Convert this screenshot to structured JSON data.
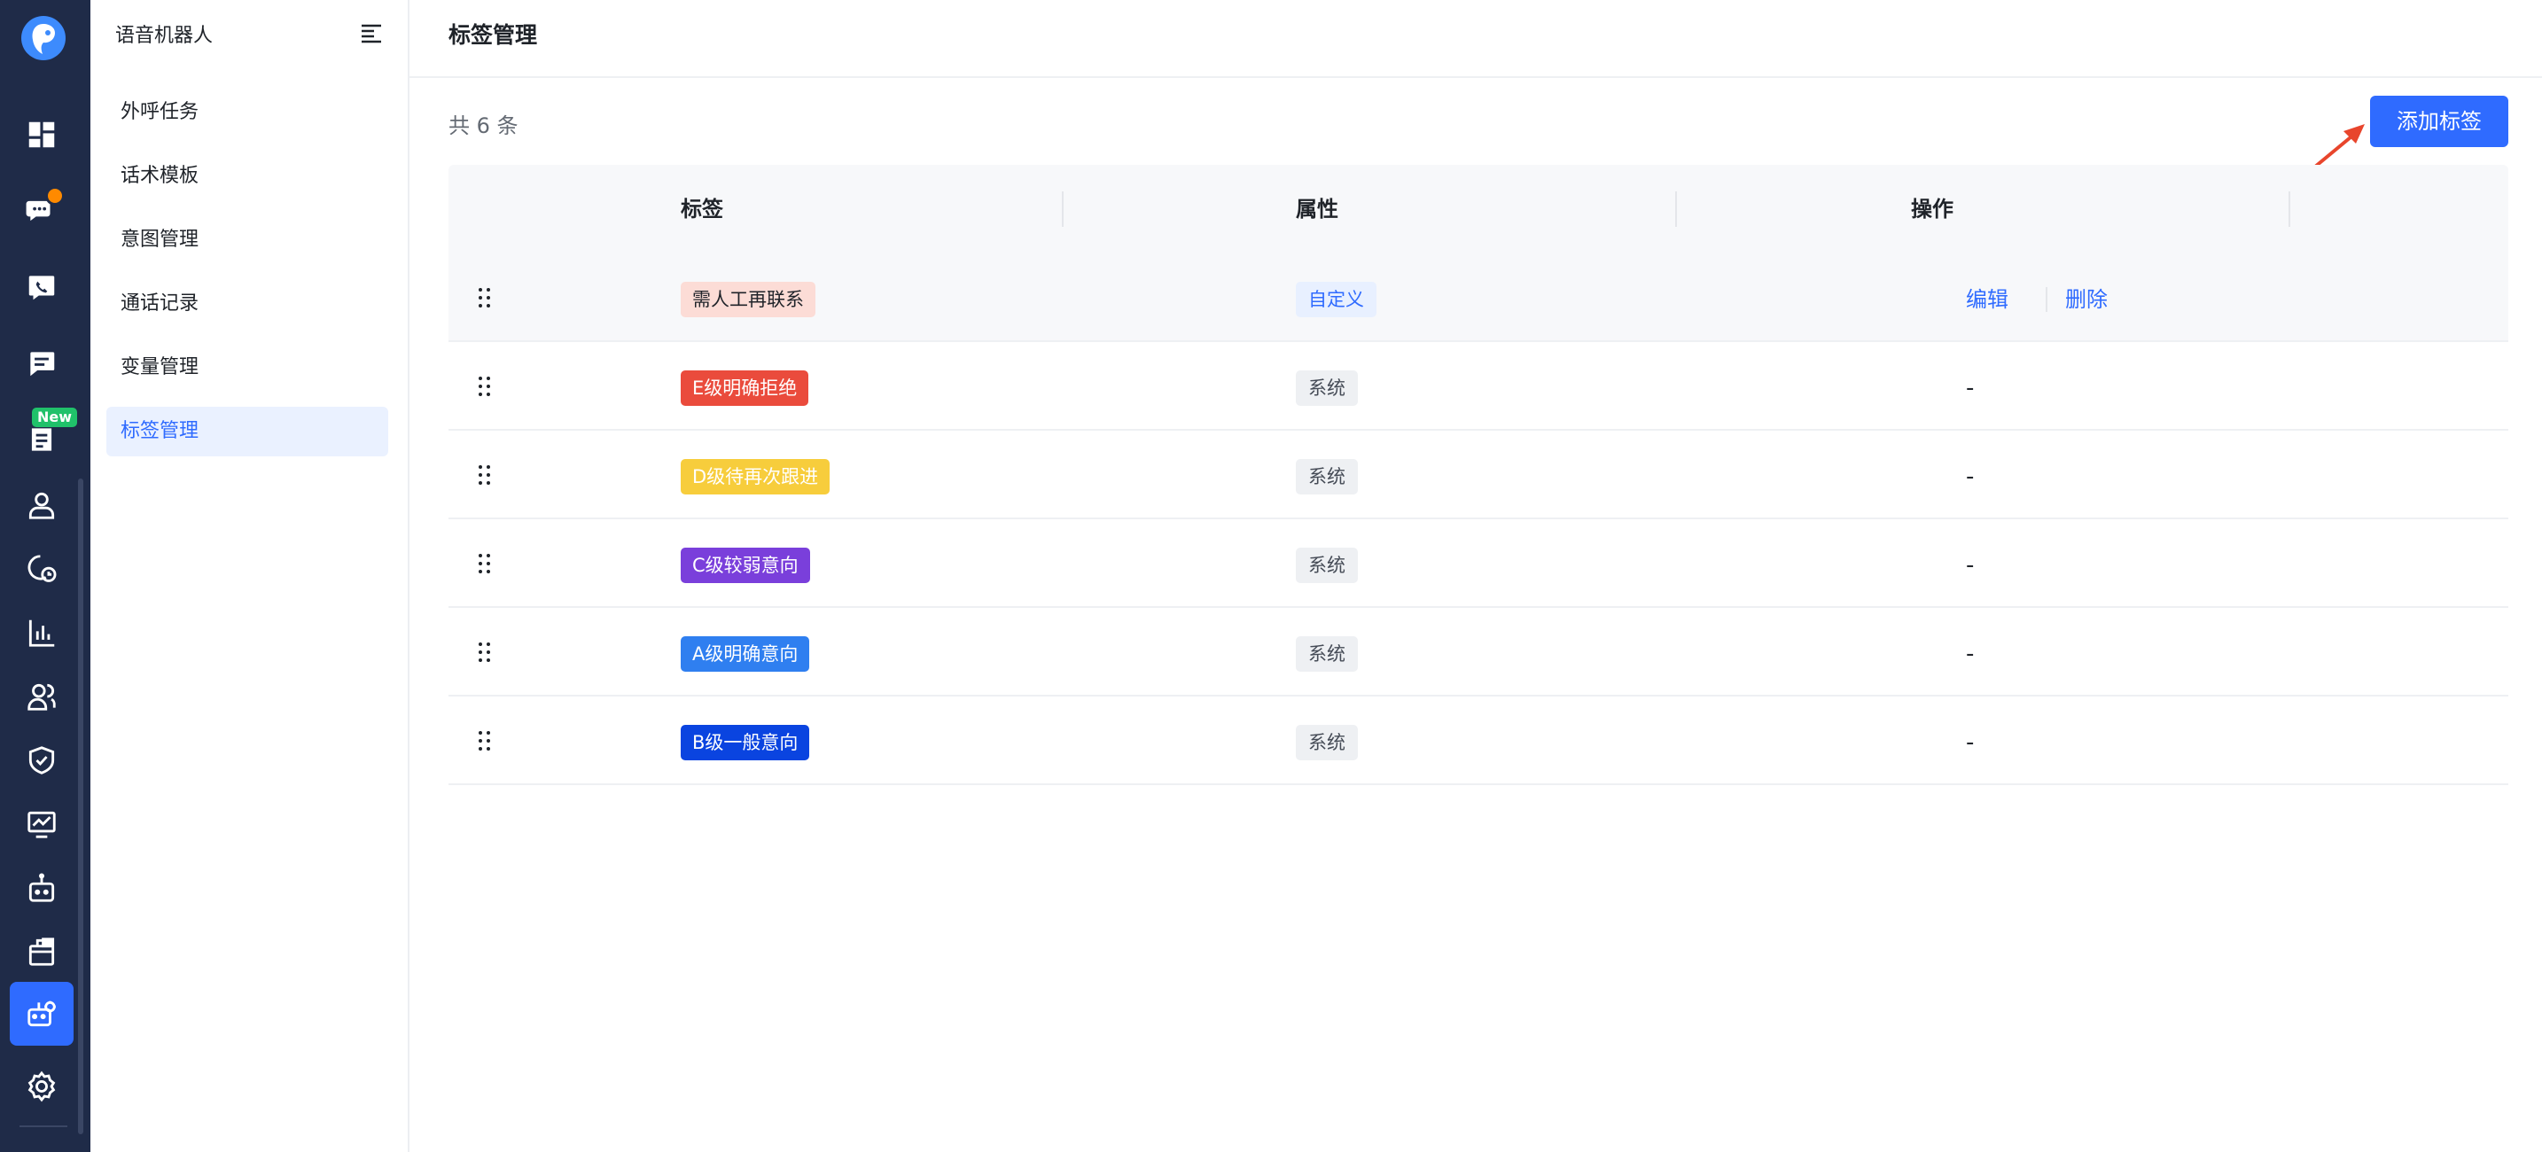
{
  "submenu": {
    "title": "语音机器人",
    "items": [
      {
        "label": "外呼任务"
      },
      {
        "label": "话术模板"
      },
      {
        "label": "意图管理"
      },
      {
        "label": "通话记录"
      },
      {
        "label": "变量管理"
      },
      {
        "label": "标签管理",
        "active": true
      }
    ]
  },
  "rail": {
    "new_badge": "New",
    "icons": [
      "dashboard-icon",
      "chat-bubbles-icon",
      "phone-chat-icon",
      "message-icon",
      "doc-icon",
      "user-icon",
      "clock-chat-icon",
      "bar-chart-icon",
      "users-icon",
      "shield-check-icon",
      "monitor-chart-icon",
      "robot-icon",
      "package-icon",
      "robot-settings-icon",
      "gear-icon"
    ]
  },
  "main": {
    "page_title": "标签管理",
    "total": "共 6 条",
    "add_button": "添加标签",
    "columns": [
      "标签",
      "属性",
      "操作"
    ],
    "rows": [
      {
        "tag": "需人工再联系",
        "tag_bg": "#fcdcd6",
        "tag_fg": "#1f2329",
        "attr": "自定义",
        "attr_type": "custom",
        "edit": "编辑",
        "delete": "删除"
      },
      {
        "tag": "E级明确拒绝",
        "tag_bg": "#ea4b3c",
        "tag_fg": "#ffffff",
        "attr": "系统",
        "attr_type": "system",
        "op": "-"
      },
      {
        "tag": "D级待再次跟进",
        "tag_bg": "#f7cd3c",
        "tag_fg": "#ffffff",
        "attr": "系统",
        "attr_type": "system",
        "op": "-"
      },
      {
        "tag": "C级较弱意向",
        "tag_bg": "#7a3fdb",
        "tag_fg": "#ffffff",
        "attr": "系统",
        "attr_type": "system",
        "op": "-"
      },
      {
        "tag": "A级明确意向",
        "tag_bg": "#2f7ff0",
        "tag_fg": "#ffffff",
        "attr": "系统",
        "attr_type": "system",
        "op": "-"
      },
      {
        "tag": "B级一般意向",
        "tag_bg": "#0a44e0",
        "tag_fg": "#ffffff",
        "attr": "系统",
        "attr_type": "system",
        "op": "-"
      }
    ]
  },
  "colors": {
    "accent": "#2f6bff",
    "rail_bg": "#1f2b48",
    "arrow": "#e8452c"
  }
}
